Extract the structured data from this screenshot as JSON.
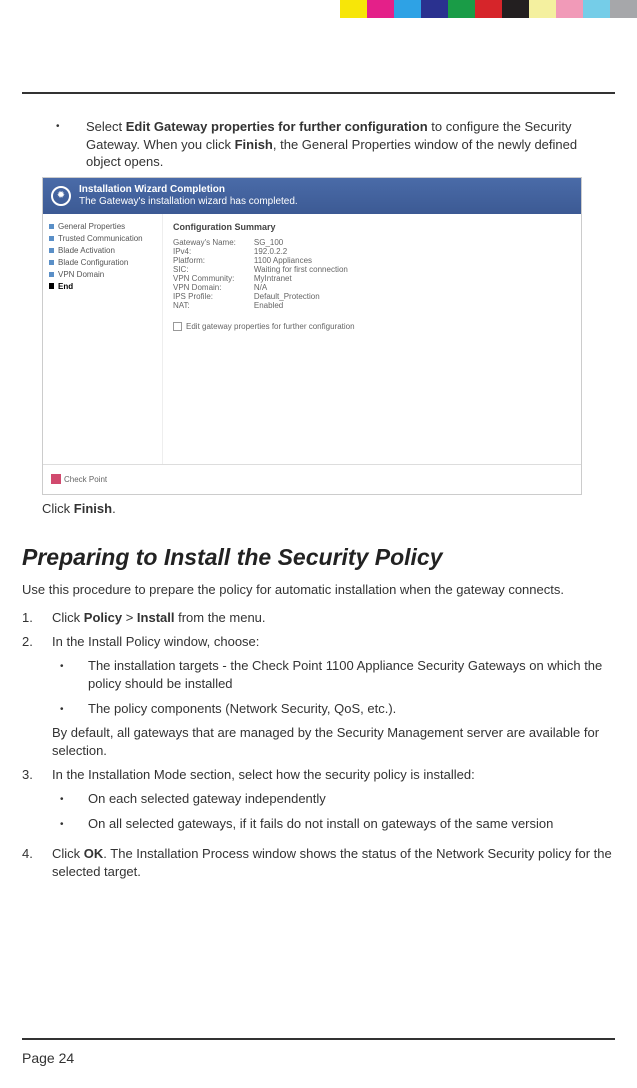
{
  "colorBar": [
    "#f7e608",
    "#e42089",
    "#2ea2e5",
    "#2a318f",
    "#1a9c47",
    "#d6252a",
    "#231f20",
    "#f4f09f",
    "#f19ab8",
    "#75cde8",
    "#a6a7aa"
  ],
  "topBullet": {
    "pre": "Select ",
    "bold1": "Edit Gateway properties for further configuration",
    "mid": " to configure the Security Gateway. When you click ",
    "bold2": "Finish",
    "post": ", the General Properties window of the newly defined object opens."
  },
  "wizard": {
    "title": "Installation Wizard Completion",
    "subtitle": "The Gateway's installation wizard has completed.",
    "sidebar": [
      "General Properties",
      "Trusted Communication",
      "Blade Activation",
      "Blade Configuration",
      "VPN Domain"
    ],
    "sidebarActive": "End",
    "summaryHeading": "Configuration Summary",
    "summary": [
      {
        "label": "Gateway's Name:",
        "value": "SG_100"
      },
      {
        "label": "IPv4:",
        "value": "192.0.2.2"
      },
      {
        "label": "Platform:",
        "value": "1100 Appliances"
      },
      {
        "label": "SIC:",
        "value": "Waiting for first connection"
      },
      {
        "label": "VPN Community:",
        "value": "MyIntranet"
      },
      {
        "label": "VPN Domain:",
        "value": "N/A"
      },
      {
        "label": "IPS Profile:",
        "value": "Default_Protection"
      },
      {
        "label": "NAT:",
        "value": "Enabled"
      }
    ],
    "checkbox": "Edit gateway properties for further configuration",
    "footerLogo": "Check Point"
  },
  "clickFinish": {
    "pre": "Click ",
    "bold": "Finish",
    "post": "."
  },
  "heading": "Preparing to Install the Security Policy",
  "intro": "Use this procedure to prepare the policy for automatic installation when the gateway connects.",
  "steps": {
    "s1": {
      "num": "1.",
      "pre": "Click ",
      "b1": "Policy",
      "mid": " > ",
      "b2": "Install",
      "post": " from the menu."
    },
    "s2": {
      "num": "2.",
      "text": "In the Install Policy window, choose:",
      "bullets": [
        "The installation targets - the Check Point 1100 Appliance Security Gateways on which the policy should be installed",
        "The policy components (Network Security, QoS, etc.)."
      ],
      "after": "By default, all gateways that are managed by the Security Management server are available for selection."
    },
    "s3": {
      "num": "3.",
      "text": "In the Installation Mode section, select how the security policy is installed:",
      "bullets": [
        "On each selected gateway independently",
        "On all selected gateways, if it fails do not install on gateways of the same version"
      ]
    },
    "s4": {
      "num": "4.",
      "pre": "Click ",
      "b1": "OK",
      "post": ". The Installation Process window shows the status of the Network Security policy for the selected target."
    }
  },
  "pageNum": "Page 24"
}
